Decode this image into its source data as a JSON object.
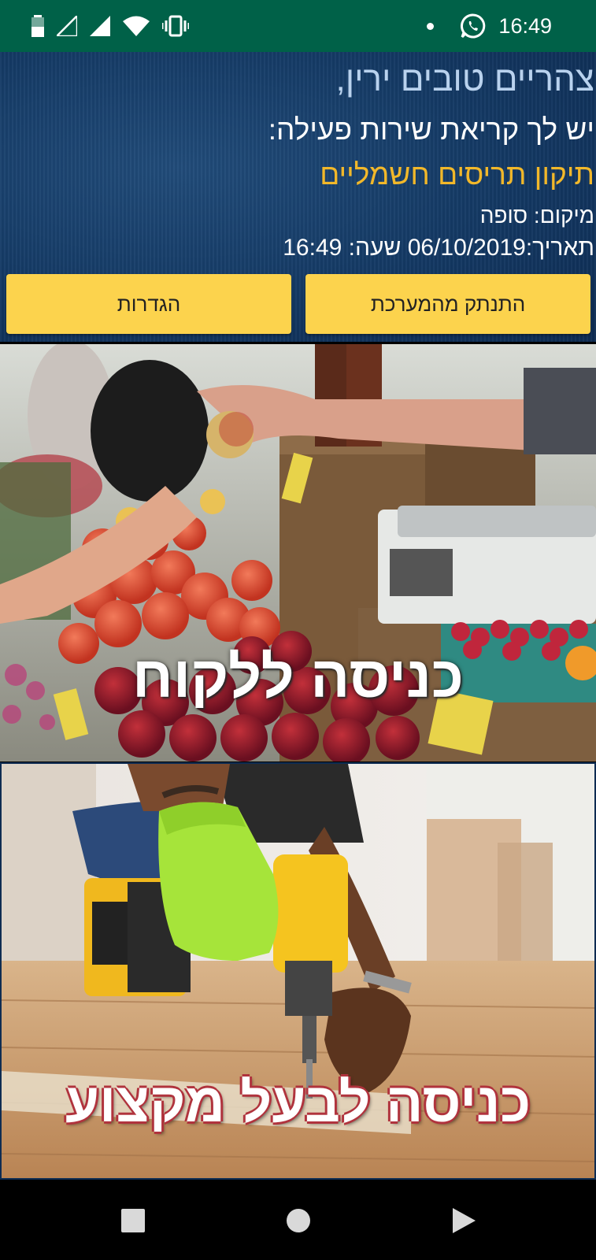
{
  "status_bar": {
    "time": "16:49",
    "icons": [
      "battery-icon",
      "signal-icon",
      "signal-icon",
      "wifi-icon",
      "vibrate-icon",
      "notification-dot-icon",
      "whatsapp-icon"
    ]
  },
  "header": {
    "greeting": "צהריים טובים ירין,",
    "call_text": "יש לך קריאת שירות פעילה:",
    "service": "תיקון תריסים חשמליים",
    "location": "מיקום: סופה",
    "datetime": "תאריך:06/10/2019 שעה: 16:49"
  },
  "buttons": {
    "logout": "התנתק מהמערכת",
    "settings": "הגדרות"
  },
  "tiles": {
    "customer_label": "כניסה ללקוח",
    "pro_label": "כניסה לבעל מקצוע"
  },
  "nav": {
    "icons": [
      "recent-apps-icon",
      "home-icon",
      "back-icon"
    ]
  },
  "colors": {
    "status_bar": "#006148",
    "header_bg": "#143964",
    "button": "#fcd34d",
    "service_text": "#f2b82a",
    "greeting_text": "#b9d2ee"
  }
}
